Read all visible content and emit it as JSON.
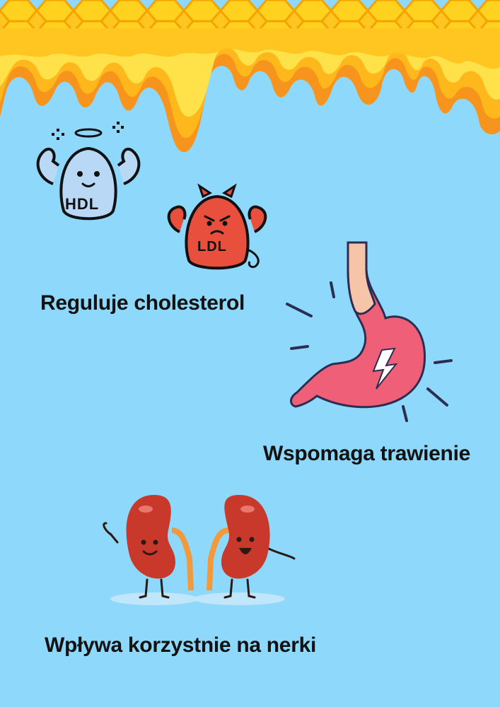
{
  "captions": {
    "cholesterol": "Reguluje cholesterol",
    "digestion": "Wspomaga trawienie",
    "kidneys": "Wpływa korzystnie na nerki"
  },
  "characters": {
    "good": "HDL",
    "bad": "LDL"
  },
  "colors": {
    "background": "#8ed8fb",
    "honey": "#ffb81c",
    "honey_dark": "#f7941d",
    "honey_light": "#ffe24a",
    "stomach": "#ef5f78",
    "kidney": "#c9392b"
  }
}
